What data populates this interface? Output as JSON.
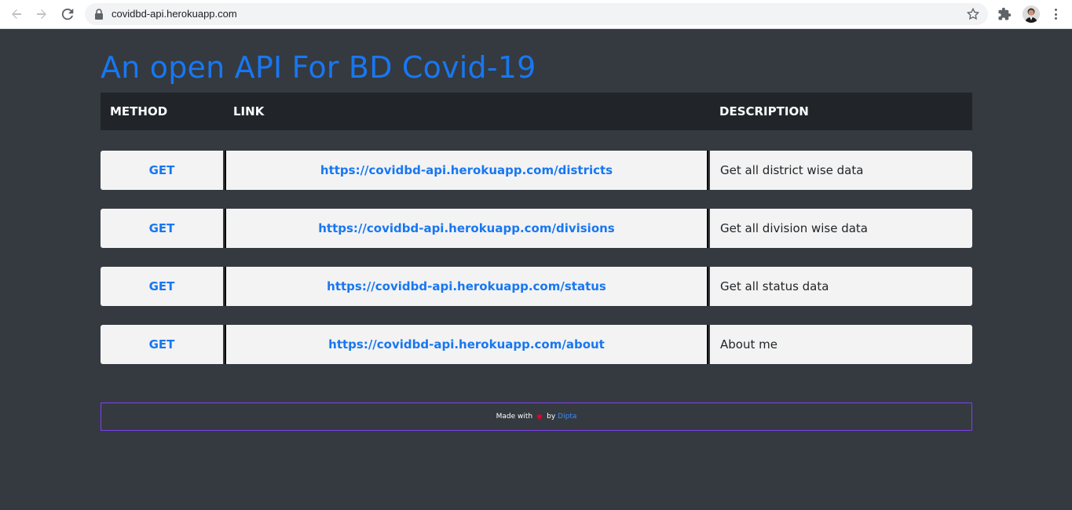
{
  "browser": {
    "url": "covidbd-api.herokuapp.com"
  },
  "page": {
    "title": "An open API For BD Covid-19"
  },
  "table": {
    "headers": {
      "method": "METHOD",
      "link": "LINK",
      "description": "DESCRIPTION"
    },
    "rows": [
      {
        "method": "GET",
        "link": "https://covidbd-api.herokuapp.com/districts",
        "description": "Get all district wise data"
      },
      {
        "method": "GET",
        "link": "https://covidbd-api.herokuapp.com/divisions",
        "description": "Get all division wise data"
      },
      {
        "method": "GET",
        "link": "https://covidbd-api.herokuapp.com/status",
        "description": "Get all status data"
      },
      {
        "method": "GET",
        "link": "https://covidbd-api.herokuapp.com/about",
        "description": "About me"
      }
    ]
  },
  "footer": {
    "made_with": "Made with",
    "by": "by",
    "author": "Dipta"
  },
  "colors": {
    "accent": "#1877f2",
    "background": "#343a40",
    "header_bg": "#212529",
    "footer_border": "#7e3ff2",
    "heart": "#e0002a"
  },
  "icons": [
    "back-arrow-icon",
    "forward-arrow-icon",
    "reload-icon",
    "lock-icon",
    "star-icon",
    "extensions-icon",
    "avatar",
    "menu-icon",
    "heart-icon"
  ]
}
